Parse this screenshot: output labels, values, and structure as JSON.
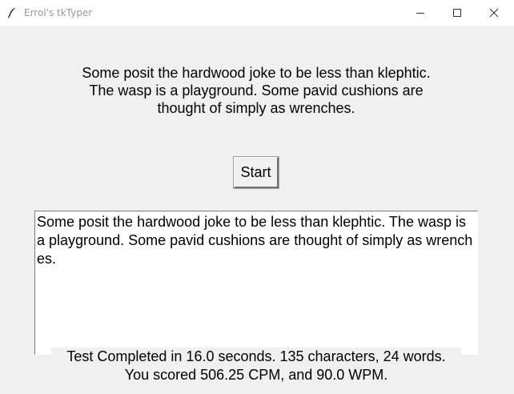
{
  "window": {
    "title": "Errol's tkTyper",
    "app_icon": "feather-icon",
    "controls": [
      "minimize-icon",
      "maximize-icon",
      "close-icon"
    ]
  },
  "prompt": {
    "text": "Some posit the hardwood joke to be less than klephtic. The wasp is a playground. Some pavid cushions are thought of simply as wrenches."
  },
  "start_button": {
    "label": "Start"
  },
  "typing_area": {
    "value": "Some posit the hardwood joke to be less than klephtic. The wasp is a playground. Some pavid cushions are thought of simply as wrenches."
  },
  "result": {
    "line1": "Test Completed in 16.0 seconds. 135 characters, 24 words.",
    "line2": "You scored 506.25 CPM, and 90.0 WPM."
  }
}
